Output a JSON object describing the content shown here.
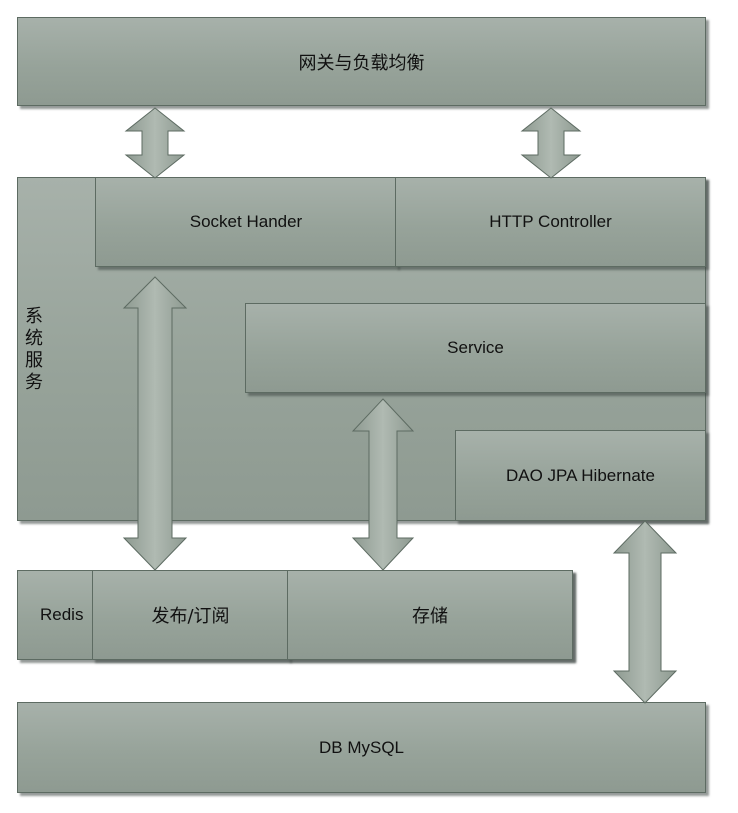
{
  "diagram": {
    "gateway": "网关与负载均衡",
    "system_service": "系统服务",
    "socket_handler": "Socket Hander",
    "http_controller": "HTTP Controller",
    "service": "Service",
    "dao": "DAO JPA Hibernate",
    "redis": "Redis",
    "pubsub": "发布/订阅",
    "storage": "存储",
    "db": "DB MySQL"
  },
  "colors": {
    "box_fill": "#9aa59d",
    "box_border": "#5d6b62",
    "arrow_fill": "#9aa59d"
  }
}
